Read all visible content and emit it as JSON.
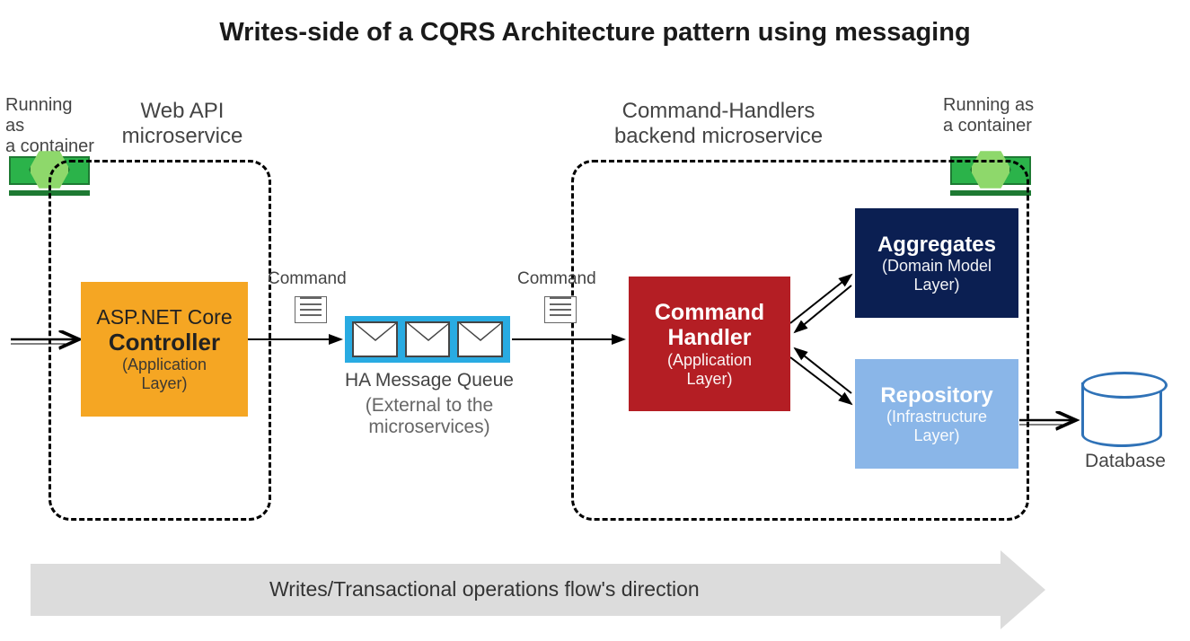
{
  "title": "Writes-side of a CQRS Architecture pattern using messaging",
  "containerLabelLeft_line1": "Running as",
  "containerLabelLeft_line2": "a container",
  "containerLabelRight_line1": "Running as",
  "containerLabelRight_line2": "a container",
  "webapi": {
    "label1": "Web API",
    "label2": "microservice"
  },
  "backend": {
    "label1": "Command-Handlers",
    "label2": "backend microservice"
  },
  "boxes": {
    "aspnet_title": "ASP.NET Core",
    "aspnet_bold": "Controller",
    "aspnet_sub1": "(Application",
    "aspnet_sub2": "Layer)",
    "cmdh_bold1": "Command",
    "cmdh_bold2": "Handler",
    "cmdh_sub1": "(Application",
    "cmdh_sub2": "Layer)",
    "agg_bold": "Aggregates",
    "agg_sub1": "(Domain Model",
    "agg_sub2": "Layer)",
    "repo_bold": "Repository",
    "repo_sub1": "(Infrastructure",
    "repo_sub2": "Layer)"
  },
  "mq": {
    "title": "HA Message Queue",
    "sub1": "(External to the",
    "sub2": "microservices)"
  },
  "cmdLabelLeft": "Command",
  "cmdLabelRight": "Command",
  "database": "Database",
  "flow": "Writes/Transactional operations flow's direction"
}
